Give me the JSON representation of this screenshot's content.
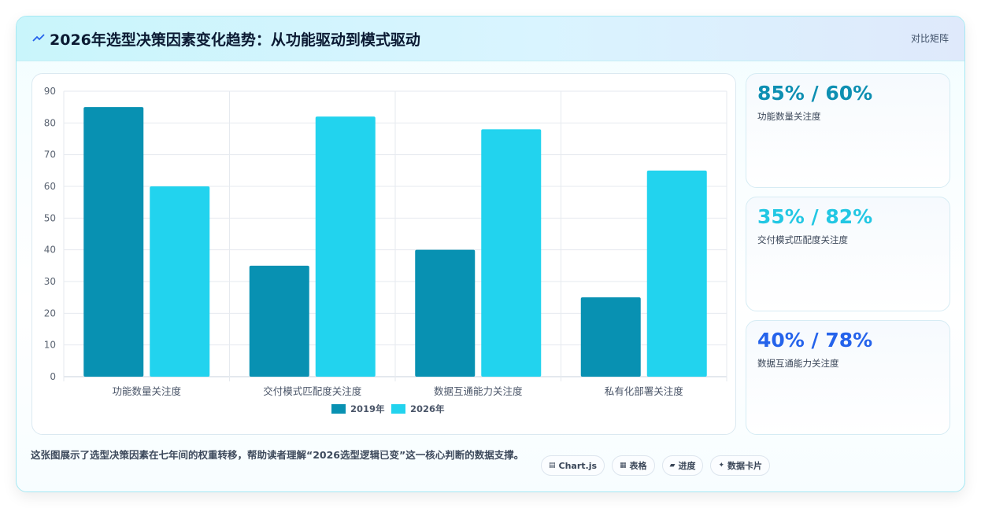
{
  "header": {
    "title": "2026年选型决策因素变化趋势：从功能驱动到模式驱动",
    "icon": "trend-line-icon",
    "badge": "对比矩阵"
  },
  "colors": {
    "series_2019": "#0891b2",
    "series_2026": "#22d3ee",
    "stat_1": "#0e8fb2",
    "stat_2": "#22c7e3",
    "stat_3": "#2563eb"
  },
  "chart_data": {
    "type": "bar",
    "categories": [
      "功能数量关注度",
      "交付模式匹配度关注度",
      "数据互通能力关注度",
      "私有化部署关注度"
    ],
    "series": [
      {
        "name": "2019年",
        "values": [
          85,
          35,
          40,
          25
        ]
      },
      {
        "name": "2026年",
        "values": [
          60,
          82,
          78,
          65
        ]
      }
    ],
    "ylim": [
      0,
      90
    ],
    "yticks": [
      0,
      10,
      20,
      30,
      40,
      50,
      60,
      70,
      80,
      90
    ],
    "grid": true,
    "legend": "bottom"
  },
  "stats": [
    {
      "value": "85% / 60%",
      "label": "功能数量关注度"
    },
    {
      "value": "35% / 82%",
      "label": "交付模式匹配度关注度"
    },
    {
      "value": "40% / 78%",
      "label": "数据互通能力关注度"
    }
  ],
  "note": "这张图展示了选型决策因素在七年间的权重转移，帮助读者理解“2026选型逻辑已变”这一核心判断的数据支撑。",
  "chips": [
    {
      "icon": "chart-icon",
      "glyph": "▤",
      "label": "Chart.js"
    },
    {
      "icon": "table-icon",
      "glyph": "▦",
      "label": "表格"
    },
    {
      "icon": "progress-icon",
      "glyph": "▰",
      "label": "进度"
    },
    {
      "icon": "sparkle-icon",
      "glyph": "✦",
      "label": "数据卡片"
    }
  ]
}
